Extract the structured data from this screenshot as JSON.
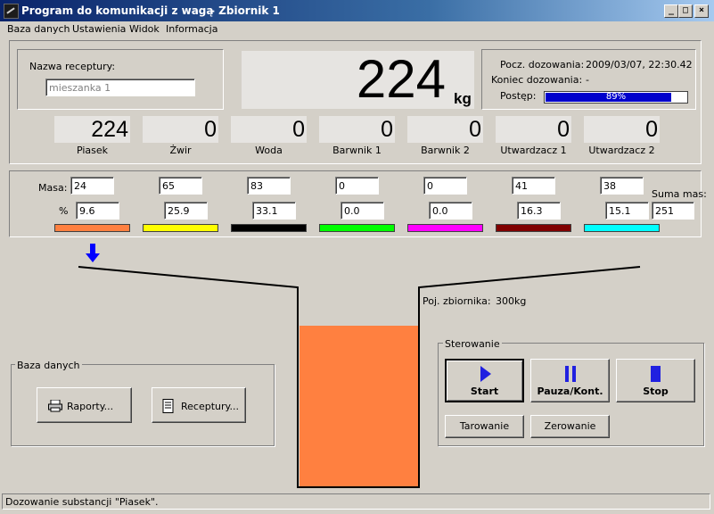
{
  "window": {
    "title": "Program do komunikacji z wagą",
    "subtitle": "- Zbiornik 1",
    "minimize": "_",
    "maximize": "□",
    "close": "×"
  },
  "menu": [
    "Baza danych",
    "Ustawienia",
    "Widok",
    "Informacja"
  ],
  "recipe": {
    "label": "Nazwa receptury:",
    "value": "mieszanka 1"
  },
  "weight": {
    "value": "224",
    "unit": "kg"
  },
  "dosing": {
    "start_label": "Pocz. dozowania:",
    "start_value": "2009/03/07, 22:30.42",
    "end_label": "Koniec dozowania:",
    "end_value": "-",
    "progress_label": "Postęp:",
    "progress_percent": 89,
    "progress_text": "89%"
  },
  "components": [
    {
      "name": "Piasek",
      "value": "224",
      "mass": "24",
      "percent": "9.6",
      "color": "#ff8040"
    },
    {
      "name": "Żwir",
      "value": "0",
      "mass": "65",
      "percent": "25.9",
      "color": "#ffff00"
    },
    {
      "name": "Woda",
      "value": "0",
      "mass": "83",
      "percent": "33.1",
      "color": "#000000"
    },
    {
      "name": "Barwnik 1",
      "value": "0",
      "mass": "0",
      "percent": "0.0",
      "color": "#00ff00"
    },
    {
      "name": "Barwnik 2",
      "value": "0",
      "mass": "0",
      "percent": "0.0",
      "color": "#ff00ff"
    },
    {
      "name": "Utwardzacz 1",
      "value": "0",
      "mass": "41",
      "percent": "16.3",
      "color": "#800000"
    },
    {
      "name": "Utwardzacz 2",
      "value": "0",
      "mass": "38",
      "percent": "15.1",
      "color": "#00ffff"
    }
  ],
  "mass_row": {
    "mass_label": "Masa:",
    "percent_label": "%",
    "sum_label": "Suma mas:",
    "sum_value": "251"
  },
  "tank": {
    "capacity_label": "Poj. zbiornika:",
    "capacity_value": "300kg",
    "fill_color": "#ff8040",
    "fill_level_percent": 68
  },
  "database_group": {
    "title": "Baza danych",
    "reports_button": "Raporty...",
    "recipes_button": "Receptury..."
  },
  "control_group": {
    "title": "Sterowanie",
    "start_button": "Start",
    "pause_button": "Pauza/Kont.",
    "stop_button": "Stop",
    "tare_button": "Tarowanie",
    "zero_button": "Zerowanie"
  },
  "status_text": "Dozowanie substancji \"Piasek\"."
}
